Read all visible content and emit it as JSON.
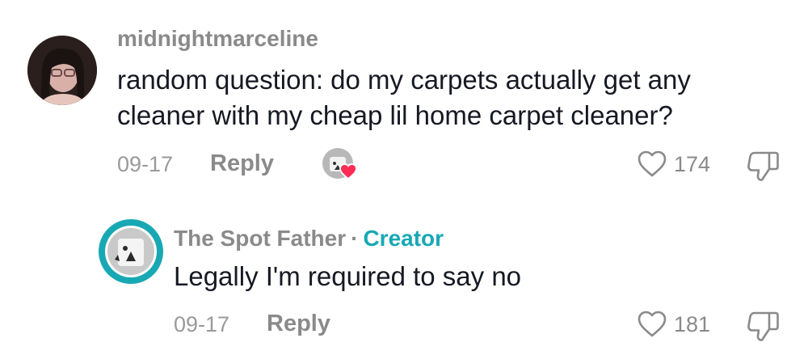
{
  "comments": [
    {
      "username": "midnightmarceline",
      "text_line1": "random question: do my carpets actually get any",
      "text_line2": "cleaner with my cheap lil home carpet cleaner?",
      "date": "09-17",
      "reply_label": "Reply",
      "likes": "174",
      "creator_liked": true
    },
    {
      "username": "The Spot Father",
      "separator": "·",
      "badge": "Creator",
      "text": "Legally I'm required to say no",
      "date": "09-17",
      "reply_label": "Reply",
      "likes": "181"
    }
  ],
  "colors": {
    "text": "#161823",
    "muted": "#8a8a8a",
    "creator": "#18a8b4",
    "heart_badge": "#fe2c55"
  },
  "icons": [
    "heart-outline-icon",
    "thumbs-down-icon",
    "liked-by-creator-heart-icon"
  ]
}
